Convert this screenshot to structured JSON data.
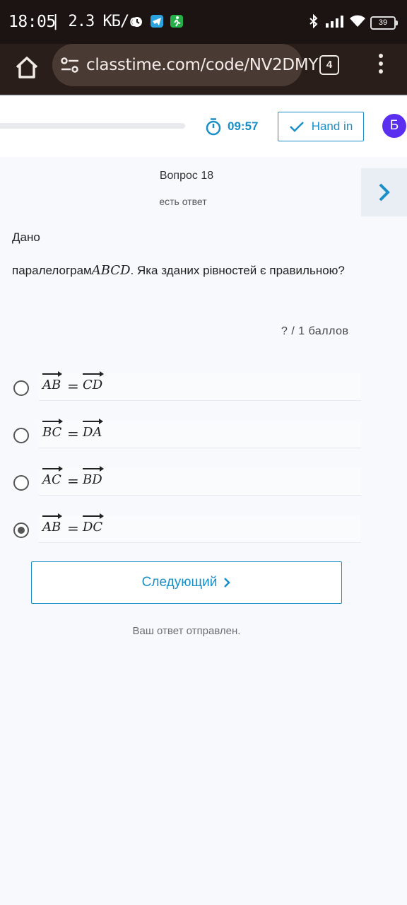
{
  "status_bar": {
    "time": "18:05",
    "speed": "| 2.3 КБ/с",
    "battery": "39"
  },
  "browser": {
    "url": "classtime.com/code/NV2DMY",
    "tab_count": "4"
  },
  "header": {
    "timer": "09:57",
    "hand_in_label": "Hand in",
    "avatar_letter": "Б"
  },
  "question": {
    "title": "Вопрос 18",
    "status": "есть ответ",
    "given_label": "Дано",
    "text_prefix": "паралелограм",
    "text_math": "ABCD",
    "text_suffix": ". Яка зданих рівностей є правильною?",
    "points": "?  /  1  баллов"
  },
  "options": [
    {
      "left": "AB",
      "right": "CD",
      "selected": false
    },
    {
      "left": "BC",
      "right": "DA",
      "selected": false
    },
    {
      "left": "AC",
      "right": "BD",
      "selected": false
    },
    {
      "left": "AB",
      "right": "DC",
      "selected": true
    }
  ],
  "equals_sign": "=",
  "actions": {
    "next_label": "Следующий",
    "submitted_text": "Ваш ответ отправлен."
  },
  "colors": {
    "accent": "#1a8fc7",
    "avatar": "#5b2ff0",
    "browser_bar": "#2a1e1a"
  }
}
